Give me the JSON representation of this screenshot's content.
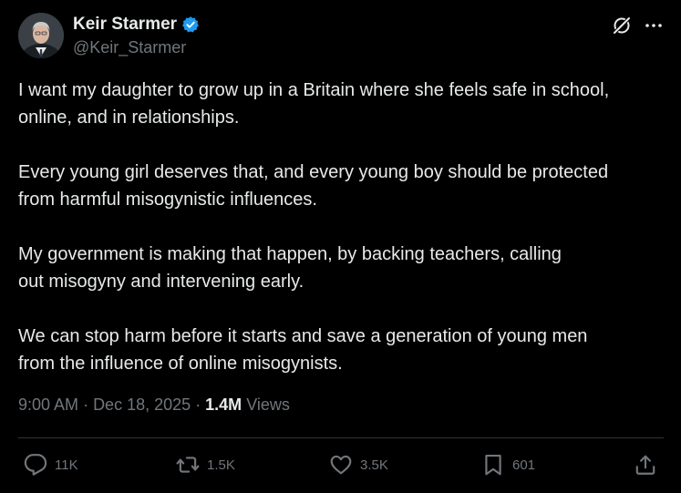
{
  "author": {
    "display_name": "Keir Starmer",
    "handle": "@Keir_Starmer",
    "verified": true,
    "verified_color": "#1d9bf0"
  },
  "header_icons": {
    "grok": "grok-icon",
    "more": "more-icon"
  },
  "tweet": {
    "paragraphs": [
      "I want my daughter to grow up in a Britain where she feels safe in school,\nonline, and in relationships.",
      "Every young girl deserves that, and every young boy should be protected\nfrom harmful misogynistic influences.",
      "My government is making that happen, by backing teachers, calling\nout misogyny and intervening early.",
      "We can stop harm before it starts and save a generation of young men\nfrom the influence of online misogynists."
    ]
  },
  "meta": {
    "time": "9:00 AM",
    "date": "Dec 18, 2025",
    "views_count": "1.4M",
    "views_label": "Views"
  },
  "actions": {
    "replies": "11K",
    "reposts": "1.5K",
    "likes": "3.5K",
    "bookmarks": "601"
  },
  "colors": {
    "background": "#000000",
    "text_primary": "#e7e9ea",
    "text_secondary": "#71767b",
    "divider": "#2f3336"
  }
}
